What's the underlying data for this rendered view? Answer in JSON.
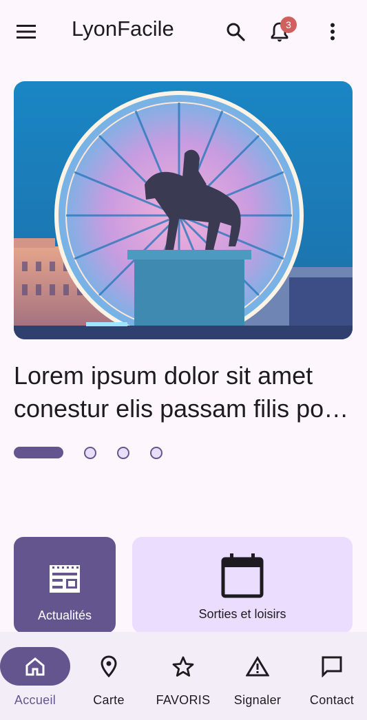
{
  "app_bar": {
    "title": "LyonFacile",
    "notification_count": "3",
    "icons": [
      "menu-icon",
      "search-icon",
      "bell-icon",
      "more-vert-icon"
    ]
  },
  "carousel": {
    "headline_line1": "Lorem ipsum dolor sit amet",
    "headline_line2": "conestur elis passam filis po…",
    "page_count": 4,
    "active_index": 0
  },
  "categories": [
    {
      "label": "Actualités",
      "icon": "newspaper-icon"
    },
    {
      "label": "Sorties et loisirs",
      "icon": "calendar-icon"
    }
  ],
  "bottom_nav": {
    "items": [
      {
        "label": "Accueil",
        "icon": "home-icon",
        "active": true
      },
      {
        "label": "Carte",
        "icon": "location-pin-icon",
        "active": false
      },
      {
        "label": "FAVORIS",
        "icon": "star-icon",
        "active": false
      },
      {
        "label": "Signaler",
        "icon": "warning-icon",
        "active": false
      },
      {
        "label": "Contact",
        "icon": "chat-icon",
        "active": false
      }
    ]
  },
  "colors": {
    "primary": "#65558f",
    "background": "#fdf7fd",
    "secondary_container": "#ebddfd",
    "badge": "#d0605e",
    "nav_background": "#f3edf7"
  }
}
